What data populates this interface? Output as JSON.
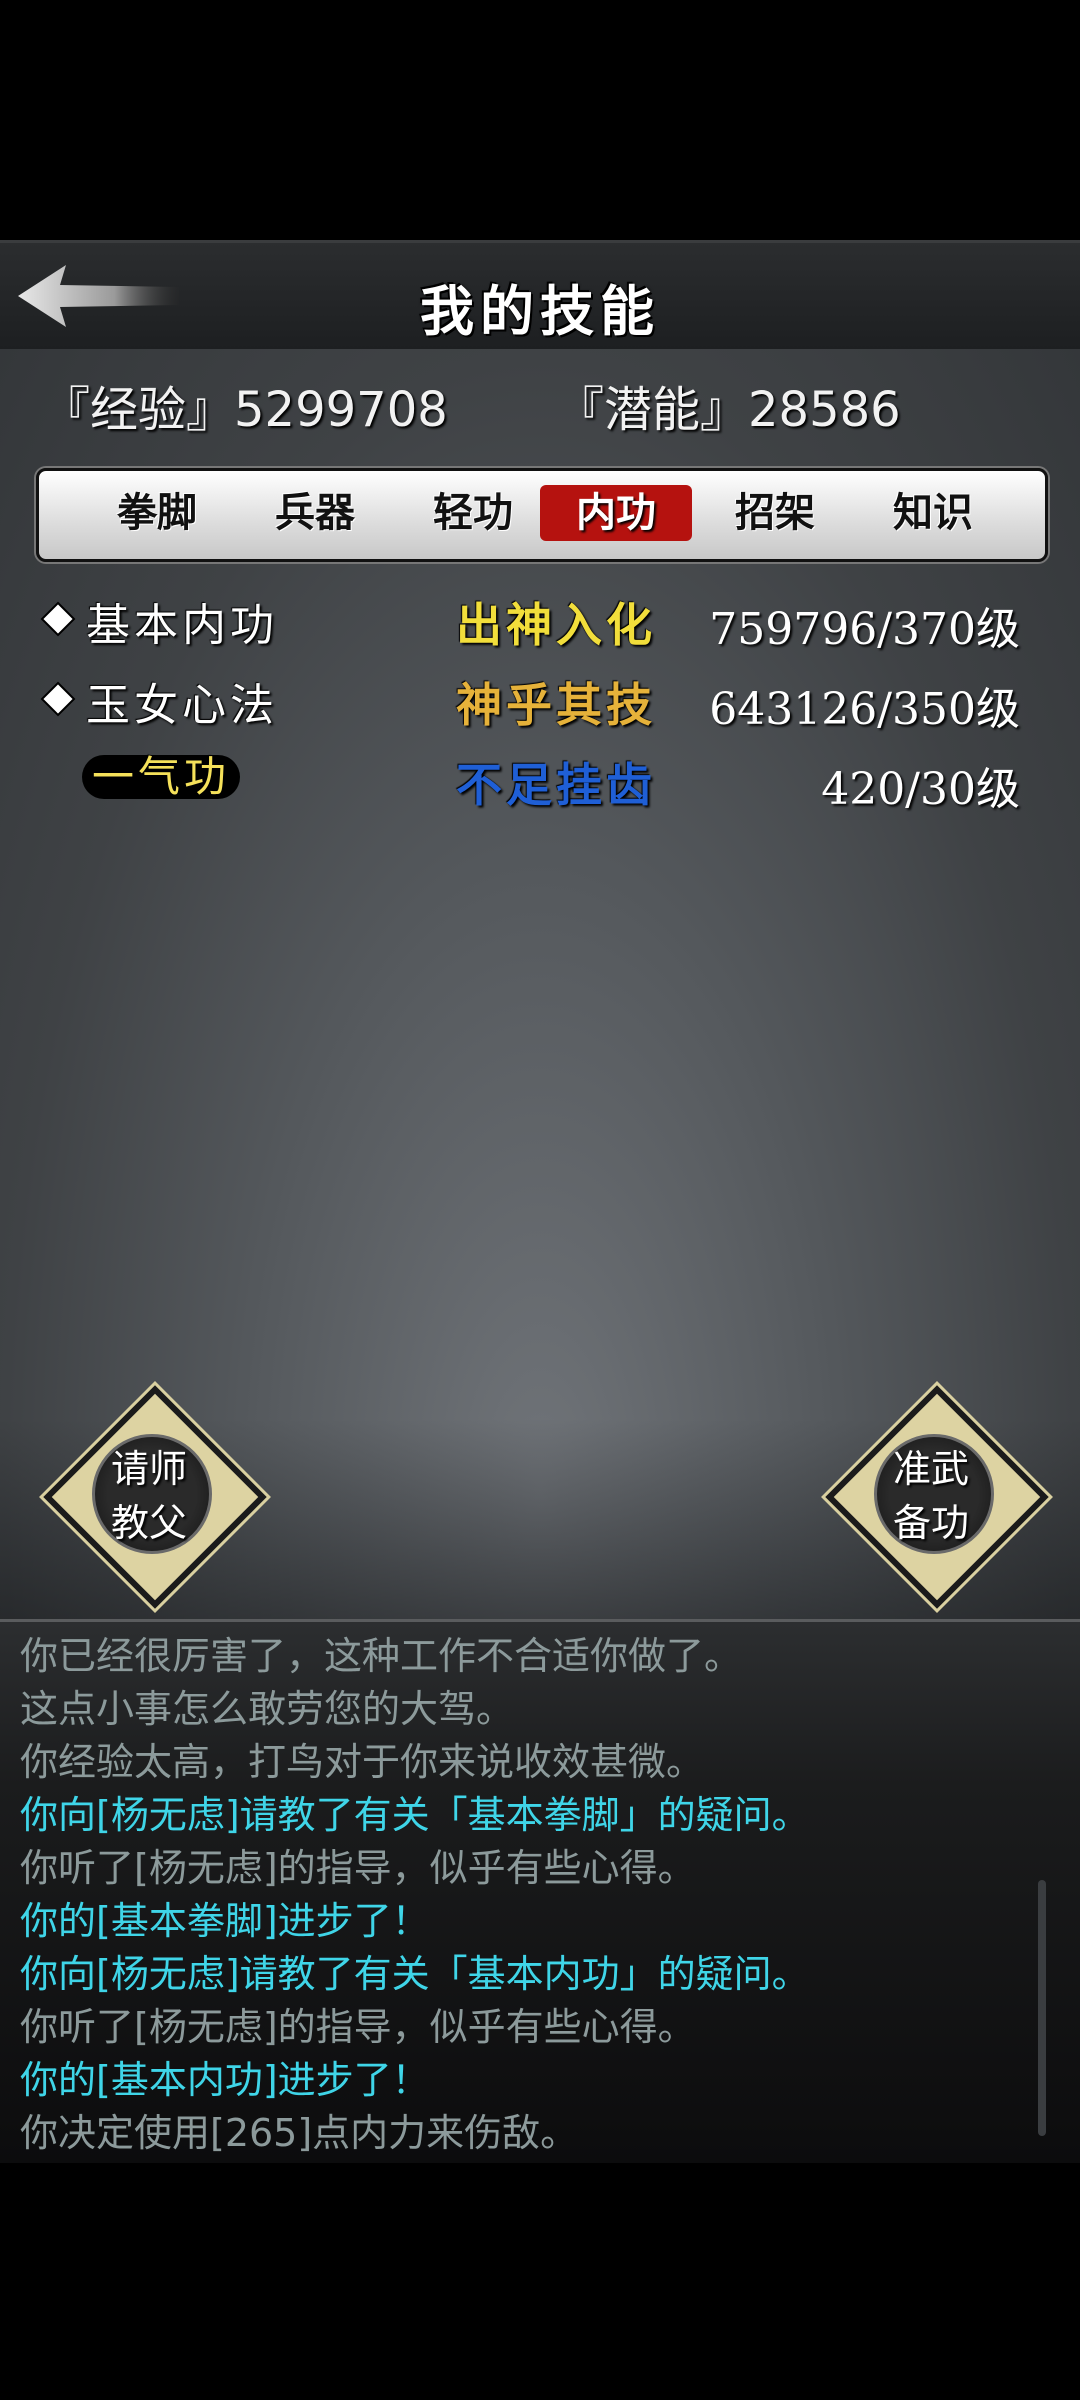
{
  "header": {
    "title": "我的技能",
    "back_icon": "arrow-left-icon"
  },
  "stats": {
    "experience": "『经验』5299708",
    "potential": "『潜能』28586"
  },
  "tabs": [
    {
      "label": "拳脚",
      "active": false
    },
    {
      "label": "兵器",
      "active": false
    },
    {
      "label": "轻功",
      "active": false
    },
    {
      "label": "内功",
      "active": true
    },
    {
      "label": "招架",
      "active": false
    },
    {
      "label": "知识",
      "active": false
    }
  ],
  "skills": [
    {
      "name": "基本内功",
      "level": "出神入化",
      "progress": "759796/370级",
      "bullet": true,
      "level_color": "#f2de3b"
    },
    {
      "name": "玉女心法",
      "level": "神乎其技",
      "progress": "643126/350级",
      "bullet": true,
      "level_color": "#e6b23a"
    },
    {
      "name": "一气功",
      "level": "不足挂齿",
      "progress": "420/30级",
      "bullet": false,
      "level_color": "#1f5fd6"
    }
  ],
  "buttons": {
    "ask_master": [
      "请师",
      "教父"
    ],
    "prepare_skill": [
      "准武",
      "备功"
    ]
  },
  "log": [
    {
      "text": "你已经很厉害了，这种工作不合适你做了。",
      "color": "gray"
    },
    {
      "text": "这点小事怎么敢劳您的大驾。",
      "color": "gray"
    },
    {
      "text": "你经验太高，打鸟对于你来说收效甚微。",
      "color": "gray"
    },
    {
      "text": "你向[杨无虑]请教了有关「基本拳脚」的疑问。",
      "color": "cyan"
    },
    {
      "text": "你听了[杨无虑]的指导，似乎有些心得。",
      "color": "gray"
    },
    {
      "text": "你的[基本拳脚]进步了！",
      "color": "cyan"
    },
    {
      "text": "你向[杨无虑]请教了有关「基本内功」的疑问。",
      "color": "cyan"
    },
    {
      "text": "你听了[杨无虑]的指导，似乎有些心得。",
      "color": "gray"
    },
    {
      "text": "你的[基本内功]进步了！",
      "color": "cyan"
    },
    {
      "text": "你决定使用[265]点内力来伤敌。",
      "color": "gray"
    }
  ],
  "colors": {
    "active_tab": "#b5120f",
    "log_gray": "#8c9a9b",
    "log_cyan": "#3fd5e8"
  }
}
